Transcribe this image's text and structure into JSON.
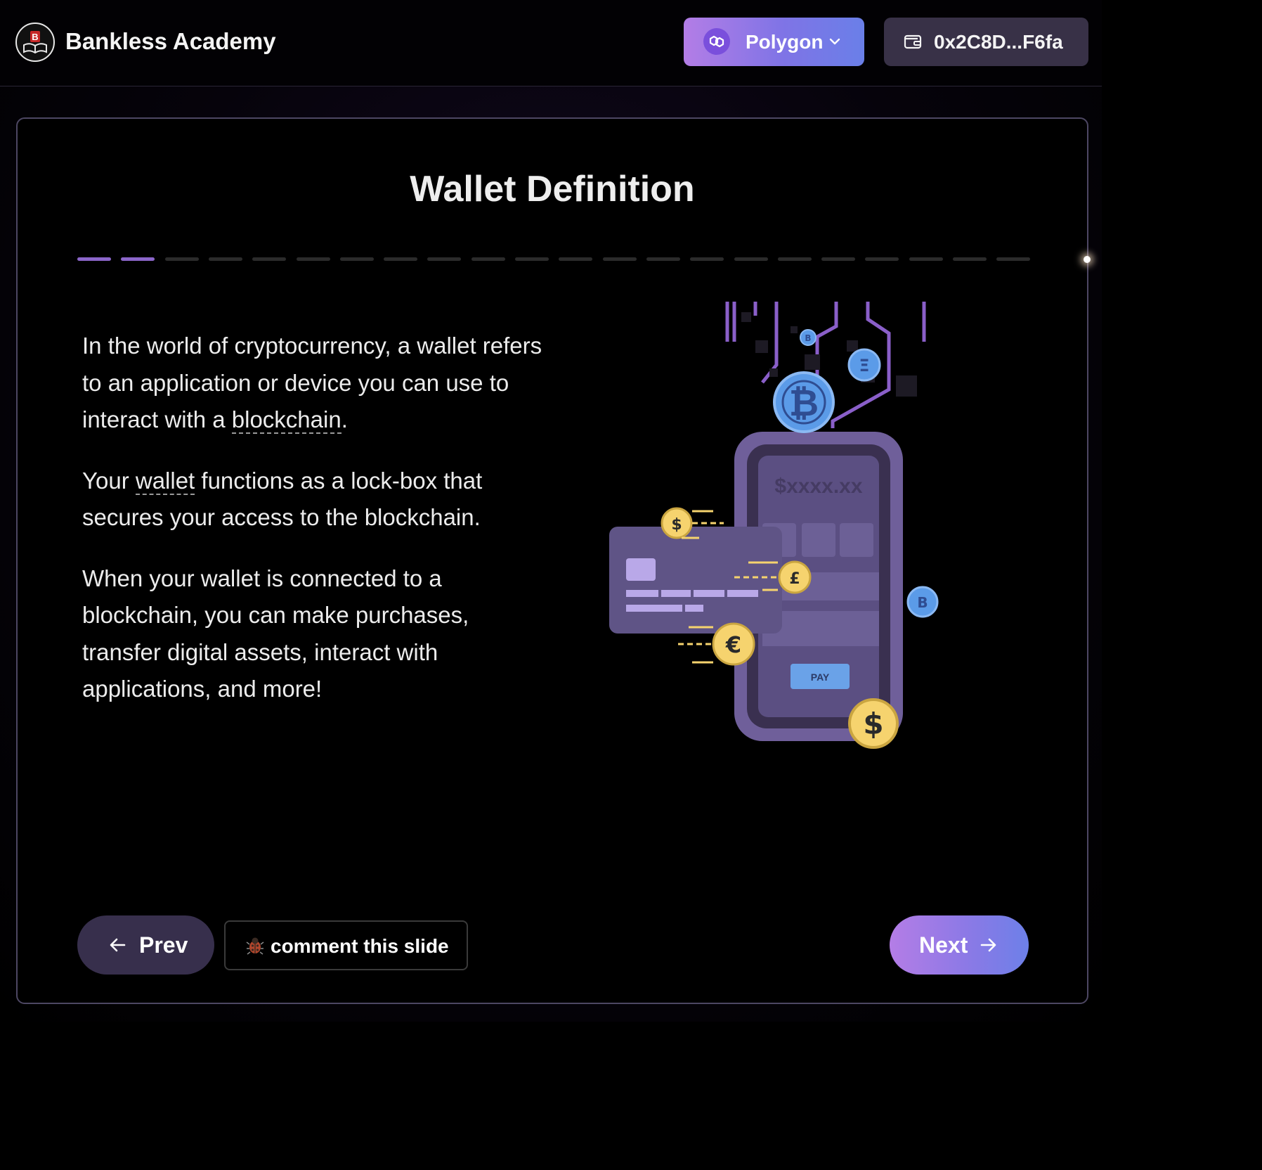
{
  "header": {
    "brand": "Bankless Academy",
    "network_label": "Polygon",
    "wallet_address": "0x2C8D...F6fa"
  },
  "slide": {
    "title": "Wallet Definition",
    "progress": {
      "current": 2,
      "total": 22
    },
    "paragraphs": [
      {
        "before": "In the world of cryptocurrency, a wallet refers to an application or device you can use to interact with a ",
        "term": "blockchain",
        "after": "."
      },
      {
        "before": "Your ",
        "term": "wallet",
        "after": " functions as a lock-box that secures your access to the blockchain."
      },
      {
        "before": "When your wallet is connected to a blockchain, you can make purchases, transfer digital assets, interact with applications, and more!",
        "term": "",
        "after": ""
      }
    ],
    "illustration": {
      "phone_amount": "$xxxx.xx",
      "pay_label": "PAY",
      "coin_symbols": [
        "₿",
        "Ξ",
        "B",
        "$",
        "£",
        "€",
        "$"
      ]
    }
  },
  "footer": {
    "prev_label": "Prev",
    "comment_label": "comment this slide",
    "next_label": "Next"
  },
  "colors": {
    "accent_purple": "#b47de6",
    "accent_blue": "#6d80e8",
    "progress_done": "#8b66c9",
    "progress_todo": "#2b2b2b"
  },
  "icons": {
    "logo": "bankless-logo-icon",
    "network": "polygon-icon",
    "chevron": "chevron-down-icon",
    "wallet": "wallet-icon",
    "prev": "arrow-left-icon",
    "next": "arrow-right-icon",
    "comment": "bug-icon"
  }
}
